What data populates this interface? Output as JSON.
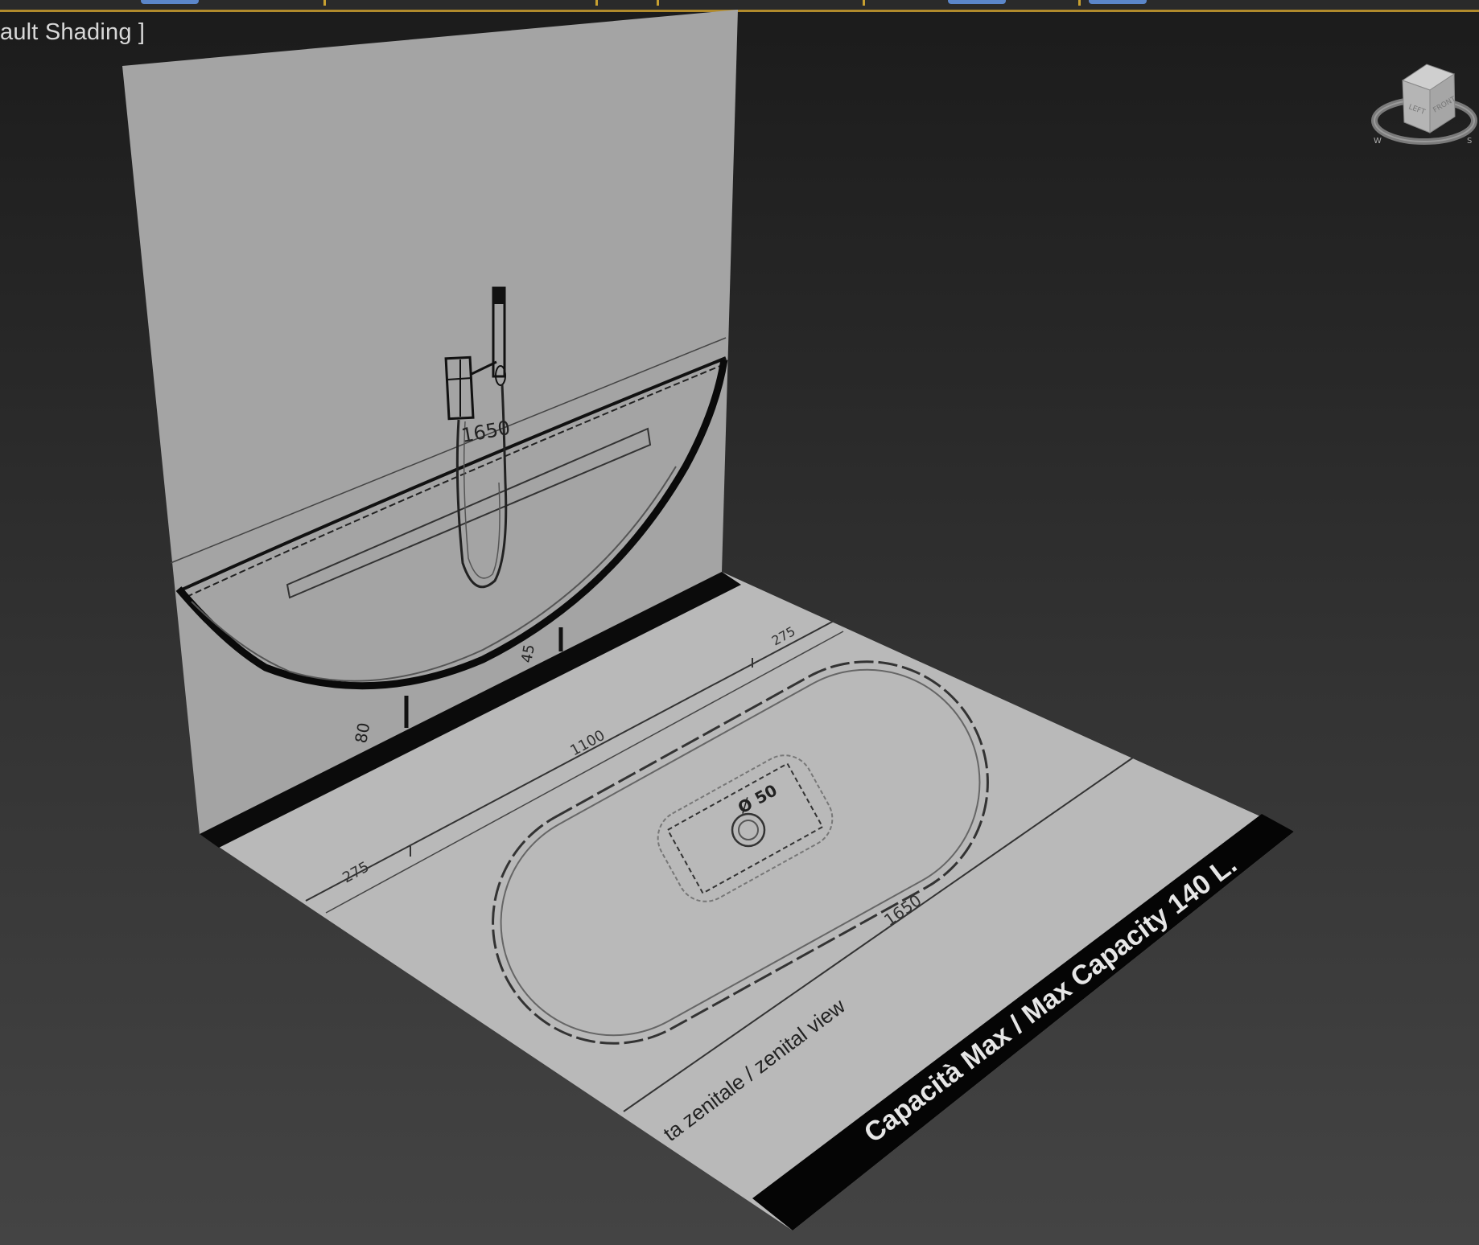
{
  "viewport": {
    "label": "[ Default Shading ]",
    "label_visible": "ault Shading ]"
  },
  "navcube": {
    "icon": "viewcube-icon",
    "faces": {
      "left": "LEFT",
      "front": "FRONT"
    },
    "ring_marks": [
      "W",
      "S"
    ]
  },
  "wall_drawing": {
    "width_dimension": "1650",
    "height_dimension_left": "80",
    "height_dimension_right": "45"
  },
  "floor_drawing": {
    "dim_top_right": "275",
    "dim_top_left": "275",
    "dim_width": "1100",
    "dim_length": "1650",
    "drain": "Ø 50",
    "view_label": "ta zenitale / zenital view",
    "capacity_text": "Capacità Max / Max Capacity",
    "capacity_value": "140 L."
  },
  "colors": {
    "background_top": "#1b1b1b",
    "background_bottom": "#444444",
    "wall_plane": "#a4a4a4",
    "floor_plane": "#b9b9b9",
    "label": "#d8d8d8",
    "accent_bar": "#b08a2c"
  }
}
